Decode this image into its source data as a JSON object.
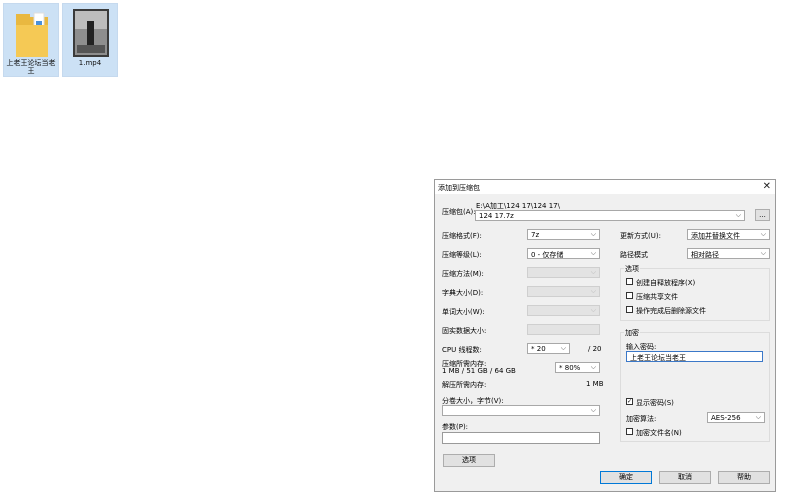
{
  "desktop": {
    "items": [
      {
        "label_line1": "上老王论坛当老",
        "label_line2": "王"
      },
      {
        "label_line1": "1.mp4",
        "label_line2": ""
      }
    ]
  },
  "dialog": {
    "title": "添加到压缩包",
    "archive_label": "压缩包(A):",
    "archive_path": "E:\\A加工\\124 17\\124 17\\",
    "archive_name": "124 17.7z",
    "browse_label": "...",
    "format_label": "压缩格式(F):",
    "format_value": "7z",
    "level_label": "压缩等级(L):",
    "level_value": "0 - 仅存储",
    "method_label": "压缩方法(M):",
    "dict_label": "字典大小(D):",
    "word_label": "单词大小(W):",
    "solid_label": "固实数据大小:",
    "cpu_label": "CPU 线程数:",
    "cpu_value": "20",
    "cpu_total": "/ 20",
    "mem_label": "压缩所需内存:",
    "mem_detail": "1 MB / 51 GB / 64 GB",
    "mem_percent": "80%",
    "decomp_label": "解压所需内存:",
    "decomp_value": "1 MB",
    "split_label": "分卷大小，字节(V):",
    "params_label": "参数(P):",
    "options_button": "选项",
    "update_label": "更新方式(U):",
    "update_value": "添加并替换文件",
    "path_label": "路径模式",
    "path_value": "相对路径",
    "options_group": "选项",
    "opt_sfx": "创建自释放程序(X)",
    "opt_shared": "压缩共享文件",
    "opt_delete": "操作完成后删除源文件",
    "enc_group": "加密",
    "pwd_label": "输入密码:",
    "pwd_value": "上老王论坛当老王",
    "show_pwd": "显示密码(S)",
    "enc_method_label": "加密算法:",
    "enc_method_value": "AES-256",
    "enc_names": "加密文件名(N)",
    "ok": "确定",
    "cancel": "取消",
    "help": "帮助"
  }
}
